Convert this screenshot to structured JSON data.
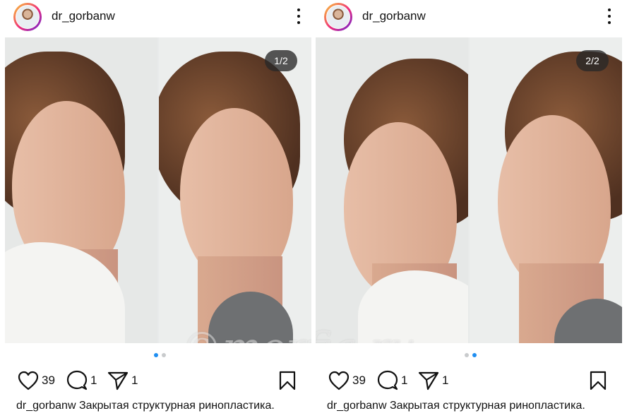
{
  "posts": [
    {
      "username": "dr_gorbanw",
      "counter": "1/2",
      "watermark": "©morfia.ru",
      "likes": "39",
      "comments": "1",
      "shares": "1",
      "caption_user": "dr_gorbanw",
      "caption_text": " Закрытая структурная ринопластика.",
      "active_slide": 1,
      "total_slides": 2
    },
    {
      "username": "dr_gorbanw",
      "counter": "2/2",
      "watermark": "©morfia.ru",
      "likes": "39",
      "comments": "1",
      "shares": "1",
      "caption_user": "dr_gorbanw",
      "caption_text": " Закрытая структурная ринопластика.",
      "active_slide": 2,
      "total_slides": 2
    }
  ],
  "icons": {
    "avatar": "avatar-icon",
    "more": "more-options-icon",
    "like": "heart-icon",
    "comment": "comment-icon",
    "share": "send-icon",
    "save": "bookmark-icon"
  },
  "colors": {
    "active_dot": "#1f8ef1",
    "inactive_dot": "#c9cbcd",
    "counter_bg": "#282828"
  }
}
